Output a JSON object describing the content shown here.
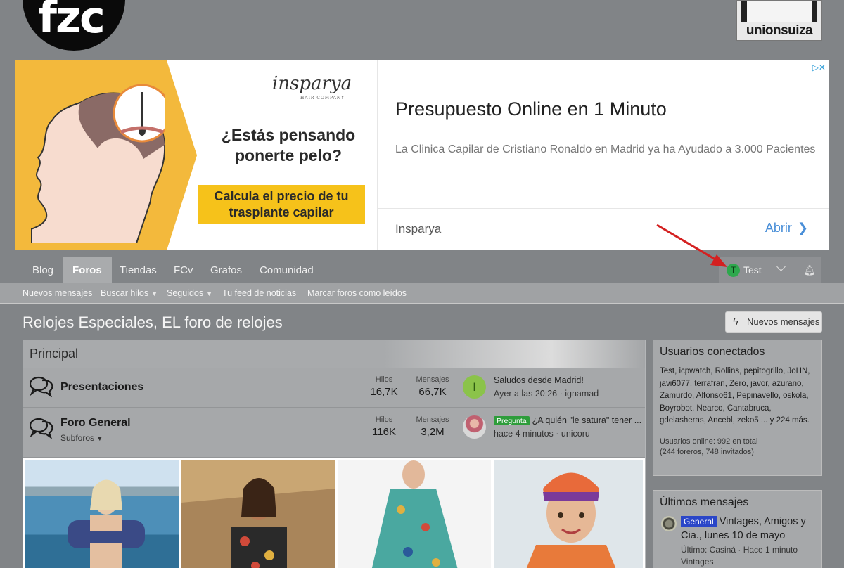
{
  "header": {
    "logo_text": "fzc",
    "sponsor_text": "unionsuiza"
  },
  "ad": {
    "brand": "insparya",
    "brand_sub": "HAIR COMPANY",
    "question_line1": "¿Estás pensando",
    "question_line2": "ponerte pelo?",
    "cta_line1": "Calcula el precio de tu",
    "cta_line2": "trasplante capilar",
    "title": "Presupuesto Online en 1 Minuto",
    "description": "La Clinica Capilar de Cristiano Ronaldo en Madrid ya ha Ayudado a 3.000 Pacientes",
    "advertiser": "Insparya",
    "open_label": "Abrir"
  },
  "nav": {
    "tabs": [
      "Blog",
      "Foros",
      "Tiendas",
      "FCv",
      "Grafos",
      "Comunidad"
    ],
    "active": "Foros",
    "user": {
      "initial": "T",
      "name": "Test"
    }
  },
  "subnav": [
    "Nuevos mensajes",
    "Buscar hilos",
    "Seguidos",
    "Tu feed de noticias",
    "Marcar foros como leídos"
  ],
  "page": {
    "title": "Relojes Especiales, EL foro de relojes",
    "new_posts_button": "Nuevos mensajes"
  },
  "forum": {
    "category": "Principal",
    "nodes": [
      {
        "title": "Presentaciones",
        "threads_label": "Hilos",
        "threads": "16,7K",
        "posts_label": "Mensajes",
        "posts": "66,7K",
        "last_avatar_initial": "I",
        "last_title": "Saludos desde Madrid!",
        "last_meta": "Ayer a las 20:26 · ignamad"
      },
      {
        "title": "Foro General",
        "subforums": "Subforos",
        "threads_label": "Hilos",
        "threads": "116K",
        "posts_label": "Mensajes",
        "posts": "3,2M",
        "last_badge": "Pregunta",
        "last_title": "¿A quién \"le satura\" tener ...",
        "last_meta": "hace 4 minutos · unicoru"
      }
    ]
  },
  "sidebar": {
    "online": {
      "title": "Usuarios conectados",
      "list": "Test, icpwatch, Rollins, pepitogrillo, JoHN, javi6077, terrafran, Zero, javor, azurano, Zamurdo, Alfonso61, Pepinavello, oskola, Boyrobot, Nearco, Cantabruca, gdelasheras, Ancebl, zeko5 ... y 224 más.",
      "total_line1": "Usuarios online: 992 en total",
      "total_line2": "(244 foreros, 748 invitados)"
    },
    "latest": {
      "title": "Últimos mensajes",
      "tag": "General",
      "post_title": "Vintages, Amigos y Cia., lunes 10 de mayo",
      "post_meta": "Último: Casiná · Hace 1 minuto",
      "post_forum": "Vintages"
    }
  },
  "colors": {
    "accent_green": "#2e9d3b",
    "link_blue": "#4a8fd8",
    "tag_blue": "#2a46c8",
    "arrow_red": "#d42020"
  }
}
